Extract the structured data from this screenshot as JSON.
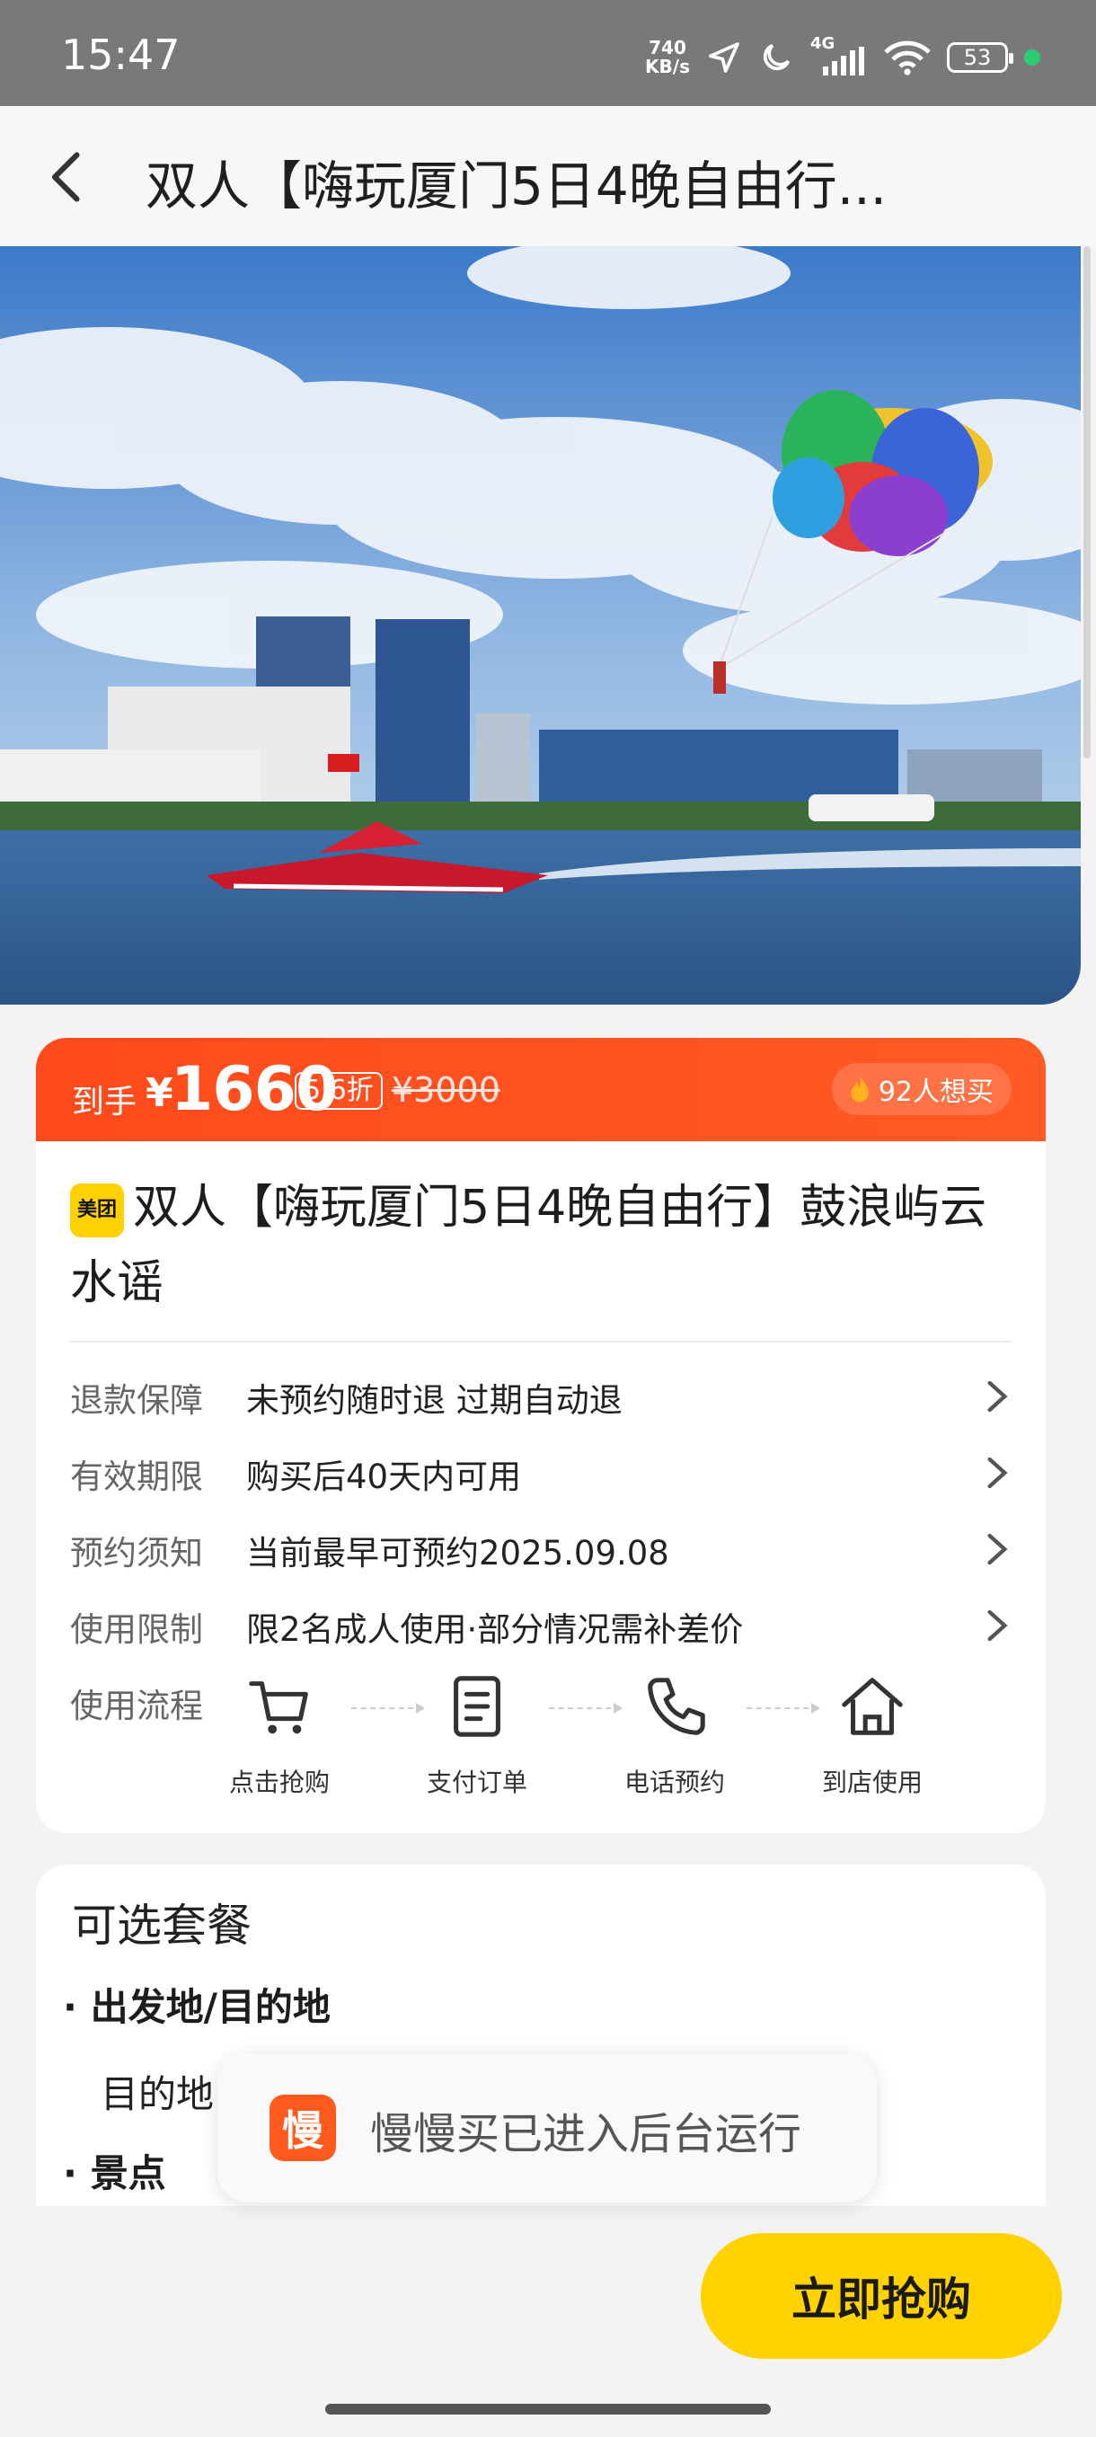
{
  "status": {
    "time": "15:47",
    "net_speed_value": "740",
    "net_speed_unit": "KB/s",
    "network": "4G",
    "battery": "53"
  },
  "nav": {
    "title": "双人【嗨玩厦门5日4晚自由行..."
  },
  "price": {
    "label": "到手",
    "currency": "¥",
    "value": "1660",
    "discount": "5.6折",
    "original": "¥3000",
    "wants": "92人想买",
    "accent_color": "#ff4a1c"
  },
  "product": {
    "badge": "美团",
    "title": "双人【嗨玩厦门5日4晚自由行】鼓浪屿云水谣",
    "rows": [
      {
        "key": "退款保障",
        "value": "未预约随时退 过期自动退"
      },
      {
        "key": "有效期限",
        "value": "购买后40天内可用"
      },
      {
        "key": "预约须知",
        "value": "当前最早可预约2025.09.08"
      },
      {
        "key": "使用限制",
        "value": "限2名成人使用·部分情况需补差价"
      }
    ],
    "flow_label": "使用流程",
    "flow_steps": [
      {
        "label": "点击抢购",
        "icon": "cart-icon"
      },
      {
        "label": "支付订单",
        "icon": "document-icon"
      },
      {
        "label": "电话预约",
        "icon": "phone-icon"
      },
      {
        "label": "到店使用",
        "icon": "home-icon"
      }
    ]
  },
  "packages": {
    "heading": "可选套餐",
    "item1": "出发地/目的地",
    "item1_text": "目的地",
    "item2": "景点"
  },
  "toast": {
    "logo_char": "慢",
    "text": "慢慢买已进入后台运行"
  },
  "buy_button": {
    "label": "立即抢购",
    "color": "#ffd200"
  }
}
